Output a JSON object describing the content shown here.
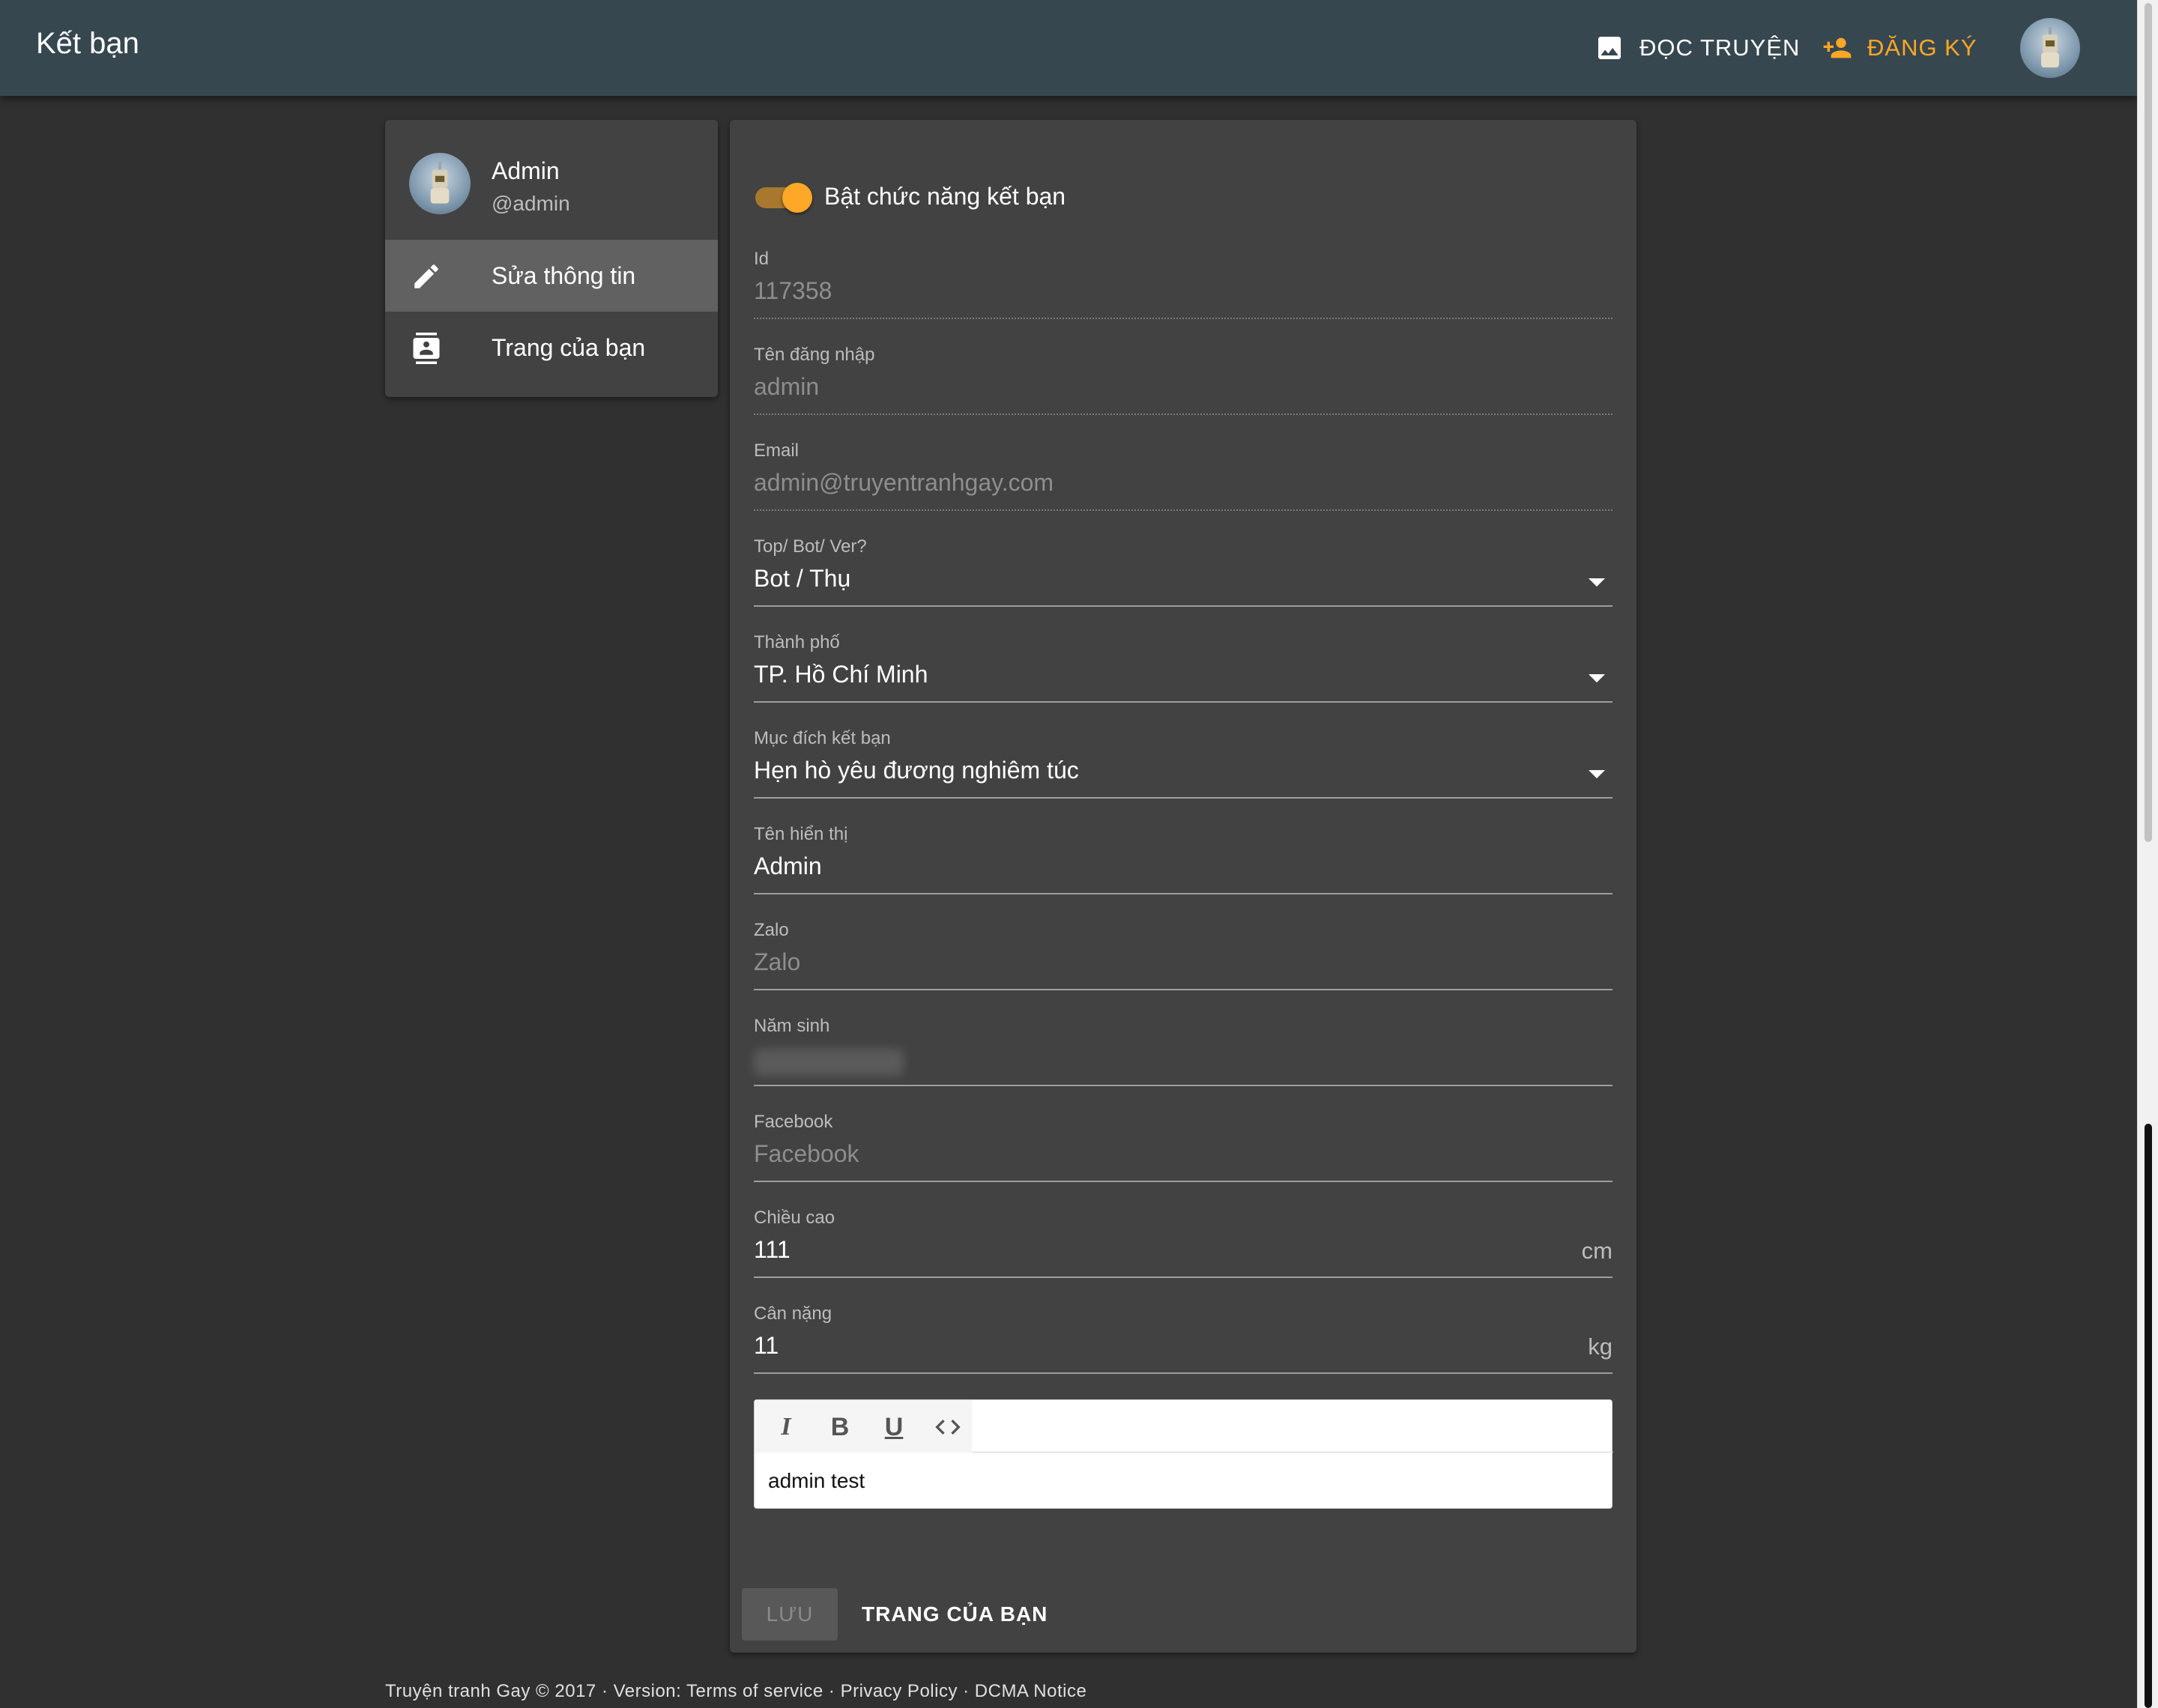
{
  "appbar": {
    "title": "Kết bạn",
    "read_label": "ĐỌC TRUYỆN",
    "register_label": "ĐĂNG KÝ"
  },
  "sidebar": {
    "name": "Admin",
    "handle": "@admin",
    "items": [
      {
        "label": "Sửa thông tin",
        "icon": "pencil-icon",
        "active": true
      },
      {
        "label": "Trang của bạn",
        "icon": "contact-card-icon",
        "active": false
      }
    ]
  },
  "form": {
    "toggle_label": "Bật chức năng kết bạn",
    "toggle_on": true,
    "id": {
      "label": "Id",
      "value": "117358"
    },
    "username": {
      "label": "Tên đăng nhập",
      "value": "admin"
    },
    "email": {
      "label": "Email",
      "value": "admin@truyentranhgay.com"
    },
    "role": {
      "label": "Top/ Bot/ Ver?",
      "value": "Bot / Thụ"
    },
    "city": {
      "label": "Thành phố",
      "value": "TP. Hồ Chí Minh"
    },
    "purpose": {
      "label": "Mục đích kết bạn",
      "value": "Hẹn hò yêu đương nghiêm túc"
    },
    "display_name": {
      "label": "Tên hiển thị",
      "value": "Admin"
    },
    "zalo": {
      "label": "Zalo",
      "placeholder": "Zalo"
    },
    "birth_year": {
      "label": "Năm sinh"
    },
    "facebook": {
      "label": "Facebook",
      "placeholder": "Facebook"
    },
    "height": {
      "label": "Chiều cao",
      "value": "111",
      "unit": "cm"
    },
    "weight": {
      "label": "Cân nặng",
      "value": "11",
      "unit": "kg"
    },
    "editor": {
      "tools": [
        "italic-icon",
        "bold-icon",
        "underline-icon",
        "code-icon"
      ],
      "content": "admin test"
    },
    "save_label": "LƯU",
    "page_label": "TRANG CỦA BẠN"
  },
  "footer": {
    "text": "Truyện tranh Gay © 2017 · Version: Terms of service · Privacy Policy · DCMA Notice"
  },
  "colors": {
    "appbar": "#37474f",
    "accent": "#ffa726",
    "background": "#303030",
    "card": "#424242"
  }
}
